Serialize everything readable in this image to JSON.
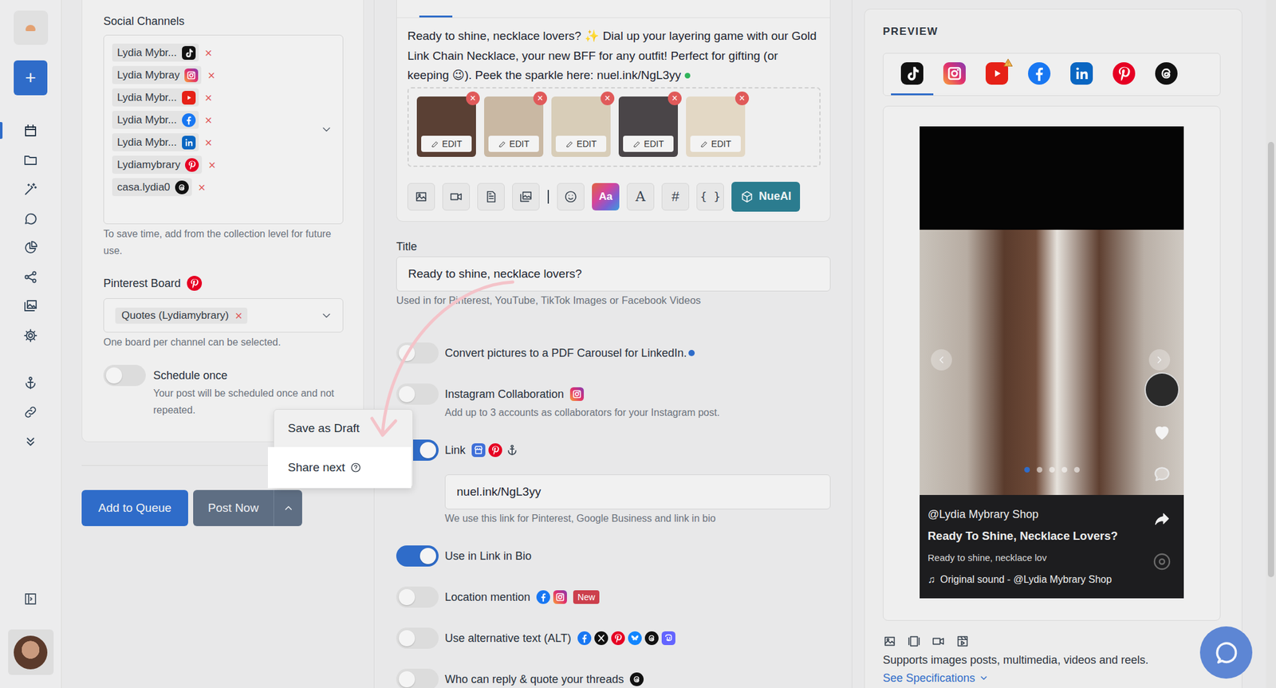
{
  "sidebar": {
    "new_post": "+",
    "items": [
      {
        "selected": true
      },
      {
        "selected": false
      },
      {
        "selected": false
      },
      {
        "selected": false
      },
      {
        "selected": false
      },
      {
        "selected": false
      },
      {
        "selected": false
      },
      {
        "selected": false
      },
      {
        "selected": false
      },
      {
        "selected": false
      },
      {
        "selected": false
      }
    ]
  },
  "channels": {
    "title": "Social Channels",
    "remove": "×",
    "accounts": [
      {
        "label": "Lydia Mybr...",
        "kind": "tiktok"
      },
      {
        "label": "Lydia Mybray",
        "kind": "instagram"
      },
      {
        "label": "Lydia Mybr...",
        "kind": "youtube"
      },
      {
        "label": "Lydia Mybr...",
        "kind": "facebook"
      },
      {
        "label": "Lydia Mybr...",
        "kind": "linkedin"
      },
      {
        "label": "Lydiamybrary",
        "kind": "pinterest"
      },
      {
        "label": "casa.lydia0",
        "kind": "threads"
      }
    ],
    "hint": "To save time, add from the collection level for future use."
  },
  "pinterest_board": {
    "label": "Pinterest Board",
    "kind": "pinterest",
    "value": "Quotes (Lydiamybrary)",
    "remove": "×",
    "hint": "One board per channel can be selected."
  },
  "schedule_once": {
    "label": "Schedule once",
    "description": "Your post will be scheduled once and not repeated.",
    "on": false
  },
  "actions": {
    "add_to_queue": "Add to Queue",
    "post_now": "Post Now"
  },
  "menu": {
    "items": [
      {
        "label": "Save as Draft",
        "help": false,
        "selected": false
      },
      {
        "label": "Share next",
        "help": true,
        "selected": true
      }
    ]
  },
  "editor": {
    "text": "Ready to shine, necklace lovers? ✨ Dial up your layering game with our Gold Link Chain Necklace, your new BFF for any outfit! Perfect for gifting (or keeping 😉). Peek the sparkle here: nuel.ink/NgL3yy",
    "link_valid": true,
    "media": [
      {
        "edit": "EDIT",
        "remove": "×",
        "color": "#5a4034"
      },
      {
        "edit": "EDIT",
        "remove": "×",
        "color": "#c9b8a3"
      },
      {
        "edit": "EDIT",
        "remove": "×",
        "color": "#d8cdb8"
      },
      {
        "edit": "EDIT",
        "remove": "×",
        "color": "#4a4548"
      },
      {
        "edit": "EDIT",
        "remove": "×",
        "color": "#e3d8c5"
      }
    ],
    "toolbar": [
      {
        "kind": "image"
      },
      {
        "kind": "video"
      },
      {
        "kind": "document"
      },
      {
        "kind": "gallery"
      },
      {
        "kind": "separator"
      },
      {
        "kind": "emoji"
      },
      {
        "kind": "text-style",
        "label": "Aa"
      },
      {
        "kind": "font",
        "label": "A"
      },
      {
        "kind": "hashtag",
        "label": "#"
      },
      {
        "kind": "variables",
        "label": "{ }"
      },
      {
        "kind": "ai",
        "label": "NueAI"
      }
    ]
  },
  "title_field": {
    "label": "Title",
    "value": "Ready to shine, necklace lovers?",
    "hint": "Used in for Pinterest, YouTube, TikTok Images or Facebook Videos"
  },
  "options": [
    {
      "label": "Convert pictures to a PDF Carousel for LinkedIn.",
      "on": false,
      "icons": [],
      "info": true
    },
    {
      "label": "Instagram Collaboration",
      "on": false,
      "icons": [
        "instagram"
      ],
      "description": "Add up to 3 accounts as collaborators for your Instagram post."
    },
    {
      "label": "Link",
      "on": true,
      "icons": [
        "google-business",
        "pinterest",
        "anchor"
      ],
      "field": "nuel.ink/NgL3yy",
      "field_hint": "We use this link for Pinterest, Google Business and link in bio"
    },
    {
      "label": "Use in Link in Bio",
      "on": true,
      "icons": []
    },
    {
      "label": "Location mention",
      "on": false,
      "icons": [
        "facebook",
        "instagram"
      ],
      "badge": "New"
    },
    {
      "label": "Use alternative text (ALT)",
      "on": false,
      "icons": [
        "facebook",
        "x",
        "pinterest",
        "bluesky",
        "threads",
        "mastodon"
      ]
    },
    {
      "label": "Who can reply & quote your threads",
      "on": false,
      "icons": [
        "threads"
      ]
    }
  ],
  "preview": {
    "title": "PREVIEW",
    "tabs": [
      {
        "kind": "tiktok",
        "selected": true,
        "warning": false
      },
      {
        "kind": "instagram",
        "selected": false,
        "warning": false
      },
      {
        "kind": "youtube",
        "selected": false,
        "warning": true
      },
      {
        "kind": "facebook",
        "selected": false,
        "warning": false
      },
      {
        "kind": "linkedin",
        "selected": false,
        "warning": false
      },
      {
        "kind": "pinterest",
        "selected": false,
        "warning": false
      },
      {
        "kind": "threads",
        "selected": false,
        "warning": false
      }
    ],
    "slides": [
      {
        "selected": true
      },
      {
        "selected": false
      },
      {
        "selected": false
      },
      {
        "selected": false
      },
      {
        "selected": false
      }
    ],
    "handle": "@Lydia Mybrary Shop",
    "headline": "Ready To Shine, Necklace Lovers?",
    "caption": "Ready to shine, necklace lov",
    "note": "♫",
    "sound": "Original sound - @Lydia Mybrary Shop",
    "formats": [
      "image",
      "multimedia",
      "video",
      "reel"
    ],
    "supports": "Supports images posts, multimedia, videos and reels.",
    "specs": "See Specifications"
  }
}
